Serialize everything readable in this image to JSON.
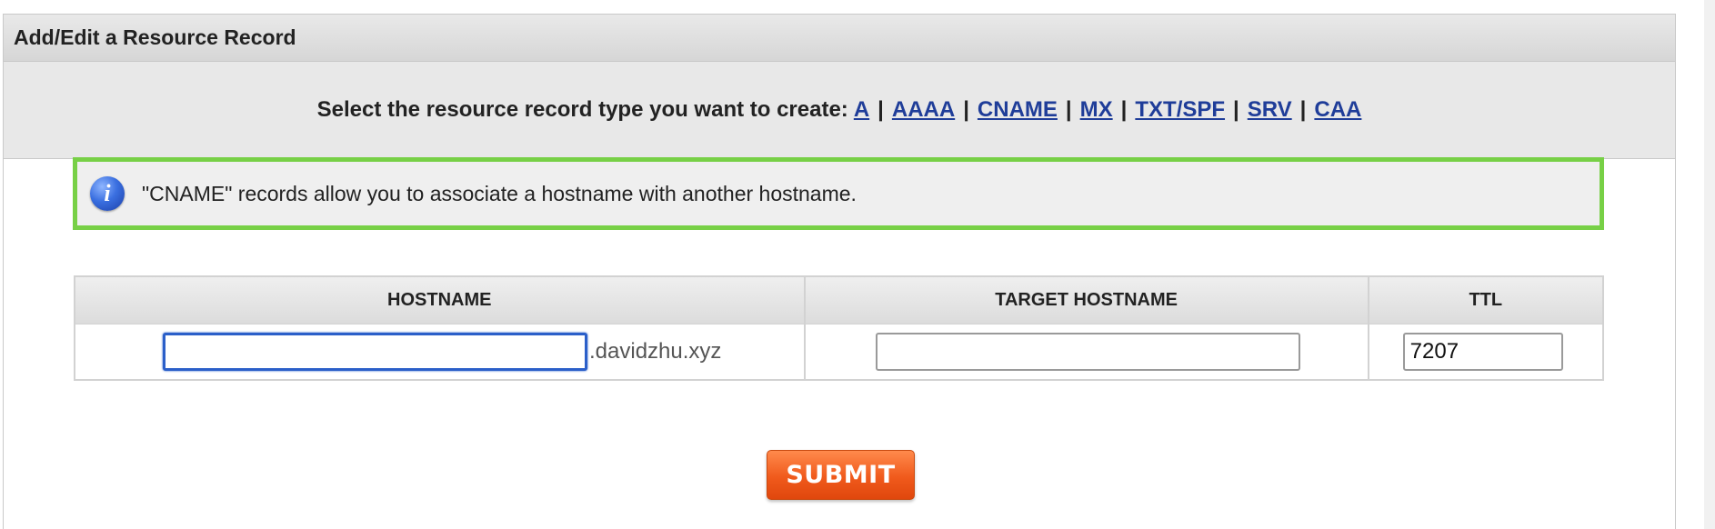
{
  "panel": {
    "title": "Add/Edit a Resource Record"
  },
  "type_selector": {
    "lead": "Select the resource record type you want to create:",
    "types": [
      "A",
      "AAAA",
      "CNAME",
      "MX",
      "TXT/SPF",
      "SRV",
      "CAA"
    ],
    "separator": "|"
  },
  "info": {
    "icon": "info-icon",
    "icon_glyph": "i",
    "text": "\"CNAME\" records allow you to associate a hostname with another hostname.",
    "border_color": "#77d046"
  },
  "table": {
    "headers": {
      "hostname": "HOSTNAME",
      "target": "TARGET HOSTNAME",
      "ttl": "TTL"
    },
    "row": {
      "hostname_value": "",
      "domain_suffix": ".davidzhu.xyz",
      "target_value": "",
      "ttl_value": "7207"
    }
  },
  "submit": {
    "label": "SUBMIT",
    "color": "#f05a1c"
  },
  "colors": {
    "link": "#1f3d99",
    "focus": "#2b5fc9"
  }
}
